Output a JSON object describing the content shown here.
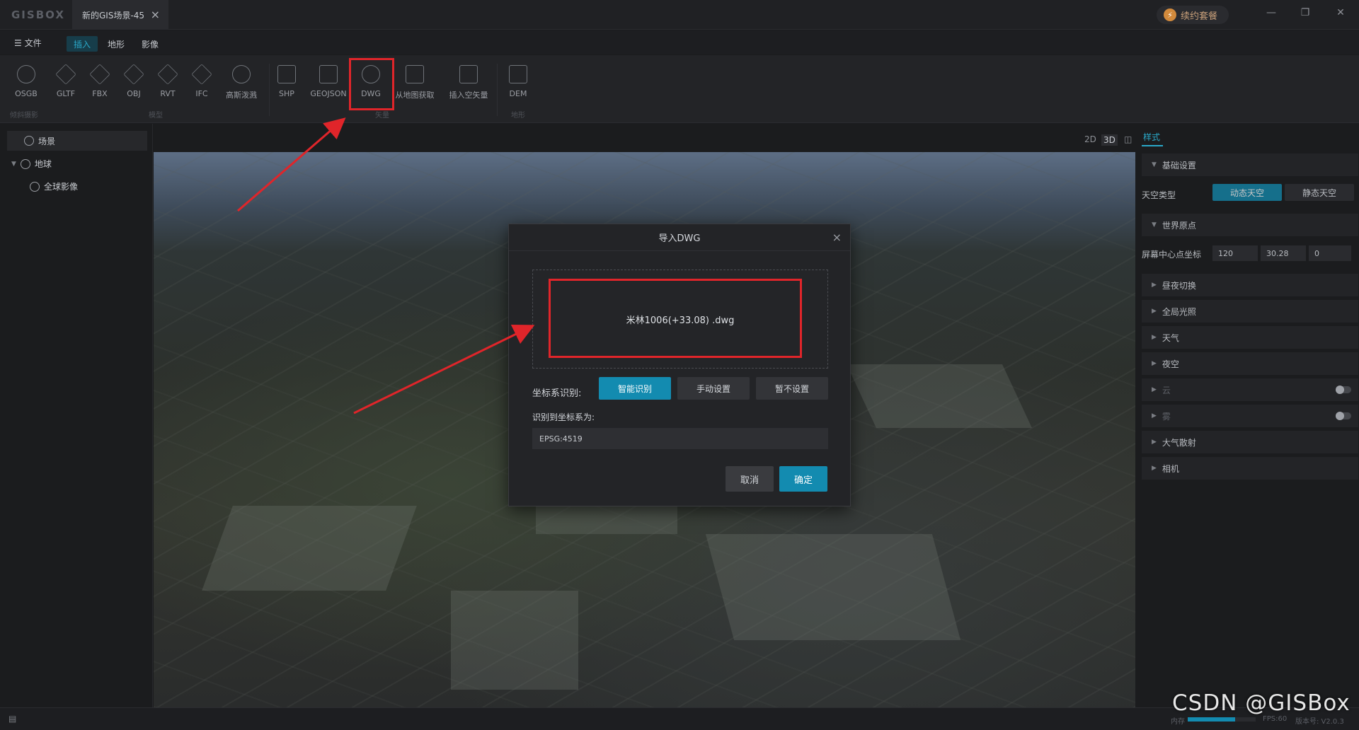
{
  "app": {
    "logo": "GISBOX",
    "doc_tab": "新的GIS场景-45",
    "renew_label": "续约套餐"
  },
  "menu": {
    "file": "文件",
    "tabs": [
      "插入",
      "地形",
      "影像"
    ],
    "active_tab": "插入"
  },
  "ribbon": {
    "items": [
      {
        "label": "OSGB",
        "icon": "drone-icon"
      },
      {
        "label": "GLTF",
        "icon": "cube-icon"
      },
      {
        "label": "FBX",
        "icon": "cube-icon"
      },
      {
        "label": "OBJ",
        "icon": "cube-icon"
      },
      {
        "label": "RVT",
        "icon": "cube-icon"
      },
      {
        "label": "IFC",
        "icon": "cube-icon"
      },
      {
        "label": "高斯泼溅",
        "icon": "gaussian-icon"
      },
      {
        "label": "SHP",
        "icon": "shp-icon"
      },
      {
        "label": "GEOJSON",
        "icon": "geojson-icon"
      },
      {
        "label": "DWG",
        "icon": "dwg-icon"
      },
      {
        "label": "从地图获取",
        "icon": "map-pin-icon"
      },
      {
        "label": "插入空矢量",
        "icon": "empty-vector-icon"
      },
      {
        "label": "DEM",
        "icon": "mountain-icon"
      }
    ],
    "groups": [
      "倾斜摄影",
      "模型",
      "矢量",
      "地形"
    ]
  },
  "left_panel": {
    "scene_tab": "场景",
    "tree": [
      {
        "label": "地球",
        "icon": "globe-icon"
      },
      {
        "label": "全球影像",
        "icon": "imagery-icon"
      }
    ]
  },
  "view_modes": [
    "2D",
    "3D"
  ],
  "right_panel": {
    "tab": "样式",
    "sections": {
      "basic": "基础设置",
      "sky_type_label": "天空类型",
      "sky_dynamic": "动态天空",
      "sky_static": "静态天空",
      "world_origin": "世界原点",
      "center_label": "屏幕中心点坐标",
      "center_x": "120",
      "center_y": "30.28",
      "center_z": "0",
      "day_night": "昼夜切换",
      "global_light": "全局光照",
      "weather": "天气",
      "night_sky": "夜空",
      "cloud": "云",
      "fog": "雾",
      "atmosphere": "大气散射",
      "camera": "相机"
    }
  },
  "dialog": {
    "title": "导入DWG",
    "file_name": "米林1006(+33.08) .dwg",
    "crs_label": "坐标系识别:",
    "crs_options": [
      "智能识别",
      "手动设置",
      "暂不设置"
    ],
    "crs_selected": "智能识别",
    "result_label": "识别到坐标系为:",
    "result_value": "EPSG:4519",
    "cancel": "取消",
    "confirm": "确定"
  },
  "status": {
    "memory": "内存",
    "fps": "FPS:60",
    "version": "版本号: V2.0.3"
  },
  "watermark": "CSDN @GISBox",
  "colors": {
    "accent": "#138bb0",
    "highlight": "#e0252a",
    "background": "#1b1c1e"
  }
}
